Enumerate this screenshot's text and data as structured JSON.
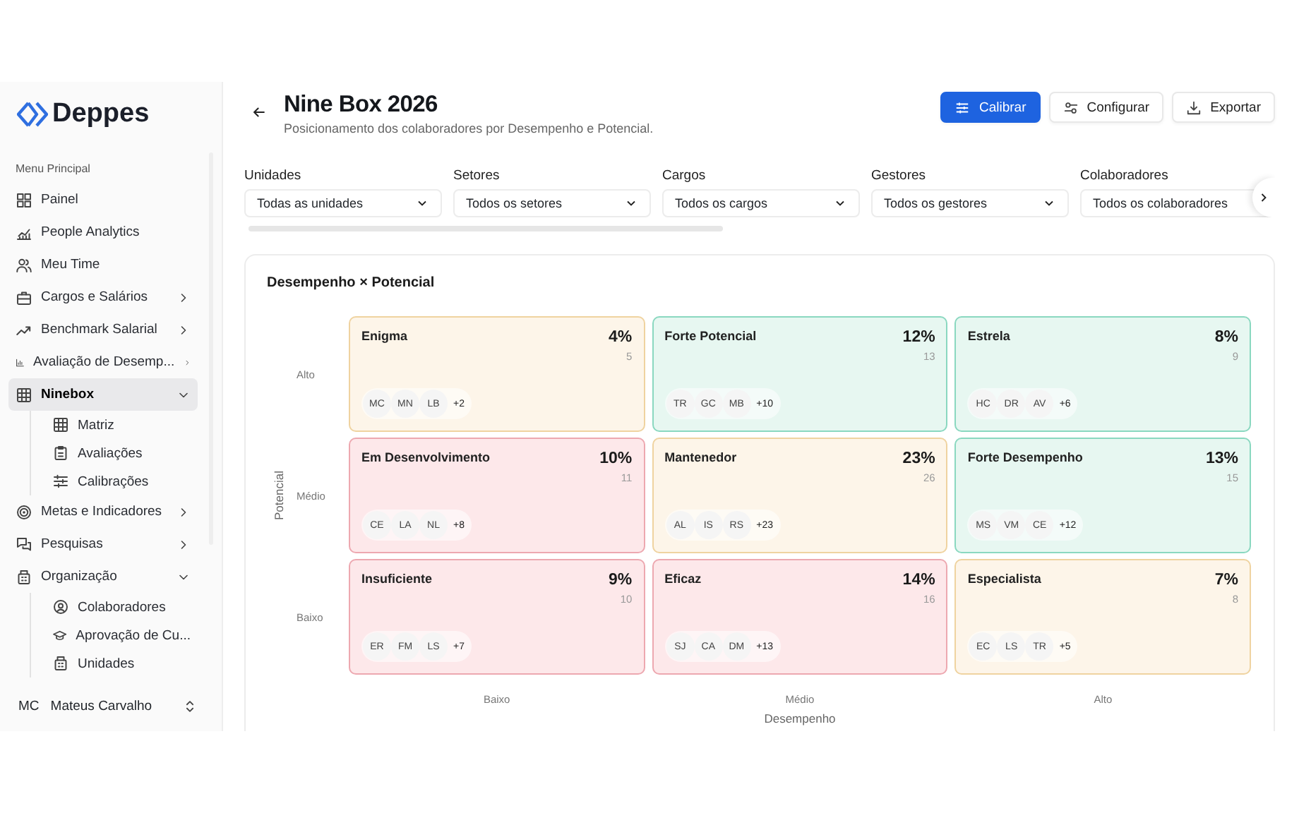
{
  "sidebar": {
    "logo": "Deppes",
    "section_label": "Menu Principal",
    "items": [
      {
        "label": "Painel",
        "selected": false
      },
      {
        "label": "People Analytics",
        "selected": false
      },
      {
        "label": "Meu Time",
        "selected": false
      },
      {
        "label": "Cargos e Salários",
        "selected": false,
        "expanded": false
      },
      {
        "label": "Benchmark Salarial",
        "selected": false,
        "expanded": false
      },
      {
        "label": "Avaliação de Desemp...",
        "selected": false,
        "expanded": false
      },
      {
        "label": "Ninebox",
        "selected": true,
        "expanded": true,
        "children": [
          {
            "label": "Matriz",
            "selected": false
          },
          {
            "label": "Avaliações",
            "selected": false
          },
          {
            "label": "Calibrações",
            "selected": false
          }
        ]
      },
      {
        "label": "Metas e Indicadores",
        "selected": false,
        "expanded": false
      },
      {
        "label": "Pesquisas",
        "selected": false,
        "expanded": false
      },
      {
        "label": "Organização",
        "selected": false,
        "expanded": true,
        "children": [
          {
            "label": "Colaboradores",
            "selected": false
          },
          {
            "label": "Aprovação de Cu...",
            "selected": false
          },
          {
            "label": "Unidades",
            "selected": false
          }
        ]
      }
    ],
    "user": {
      "initials": "MC",
      "name": "Mateus Carvalho"
    }
  },
  "header": {
    "title": "Nine Box 2026",
    "subtitle": "Posicionamento dos colaboradores por Desempenho e Potencial.",
    "buttons": [
      {
        "label": "Calibrar",
        "kind": "primary"
      },
      {
        "label": "Configurar",
        "kind": "secondary"
      },
      {
        "label": "Exportar",
        "kind": "secondary"
      }
    ]
  },
  "filters": [
    {
      "label": "Unidades",
      "value": "Todas as unidades"
    },
    {
      "label": "Setores",
      "value": "Todos os setores"
    },
    {
      "label": "Cargos",
      "value": "Todos os cargos"
    },
    {
      "label": "Gestores",
      "value": "Todos os gestores"
    },
    {
      "label": "Colaboradores",
      "value": "Todos os colaboradores"
    }
  ],
  "matrix": {
    "title": "Desempenho × Potencial",
    "y_axis": "Potencial",
    "x_axis": "Desempenho",
    "row_labels": [
      "Alto",
      "Médio",
      "Baixo"
    ],
    "column_labels": [
      "Baixo",
      "Médio",
      "Alto"
    ],
    "cells": [
      {
        "name": "Enigma",
        "percent": "4%",
        "count": "5",
        "kind": "warning",
        "avatars": [
          "MC",
          "MN",
          "LB"
        ],
        "more": "+2"
      },
      {
        "name": "Forte Potencial",
        "percent": "12%",
        "count": "13",
        "kind": "success",
        "avatars": [
          "TR",
          "GC",
          "MB"
        ],
        "more": "+10"
      },
      {
        "name": "Estrela",
        "percent": "8%",
        "count": "9",
        "kind": "success",
        "avatars": [
          "HC",
          "DR",
          "AV"
        ],
        "more": "+6"
      },
      {
        "name": "Em Desenvolvimento",
        "percent": "10%",
        "count": "11",
        "kind": "danger",
        "avatars": [
          "CE",
          "LA",
          "NL"
        ],
        "more": "+8"
      },
      {
        "name": "Mantenedor",
        "percent": "23%",
        "count": "26",
        "kind": "warning",
        "avatars": [
          "AL",
          "IS",
          "RS"
        ],
        "more": "+23"
      },
      {
        "name": "Forte Desempenho",
        "percent": "13%",
        "count": "15",
        "kind": "success",
        "avatars": [
          "MS",
          "VM",
          "CE"
        ],
        "more": "+12"
      },
      {
        "name": "Insuficiente",
        "percent": "9%",
        "count": "10",
        "kind": "danger",
        "avatars": [
          "ER",
          "FM",
          "LS"
        ],
        "more": "+7"
      },
      {
        "name": "Eficaz",
        "percent": "14%",
        "count": "16",
        "kind": "danger",
        "avatars": [
          "SJ",
          "CA",
          "DM"
        ],
        "more": "+13"
      },
      {
        "name": "Especialista",
        "percent": "7%",
        "count": "8",
        "kind": "warning",
        "avatars": [
          "EC",
          "LS",
          "TR"
        ],
        "more": "+5"
      }
    ]
  }
}
